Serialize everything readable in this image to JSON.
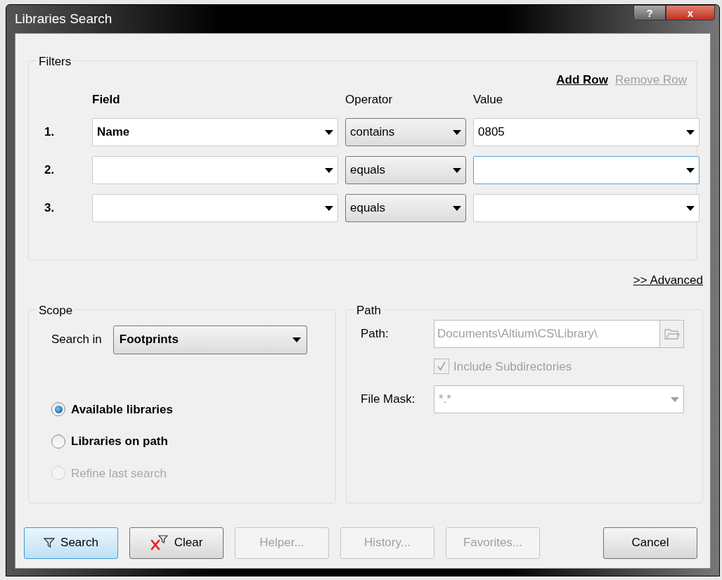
{
  "window": {
    "title": "Libraries Search",
    "help_button": "?",
    "close_button": "x"
  },
  "filters": {
    "title": "Filters",
    "add_row": {
      "label": "Add Row",
      "disabled": false
    },
    "remove_row": {
      "label": "Remove Row",
      "disabled": true
    },
    "columns": [
      "Field",
      "Operator",
      "Value"
    ],
    "rows": [
      {
        "number": "1.",
        "field": "Name",
        "operator": "contains",
        "value": "0805",
        "focused": false
      },
      {
        "number": "2.",
        "operator": "equals",
        "focused": true
      },
      {
        "number": "3.",
        "operator": "equals",
        "focused": false
      }
    ]
  },
  "advanced": ">> Advanced",
  "scope": {
    "title": "Scope",
    "search_in_label": "Search in",
    "search_in_value": "Footprints",
    "options": [
      {
        "label": "Available libraries",
        "selected": true,
        "disabled": false
      },
      {
        "label": "Libraries on path",
        "selected": false,
        "disabled": false
      },
      {
        "label": "Refine last search",
        "selected": false,
        "disabled": true
      }
    ]
  },
  "path": {
    "title": "Path",
    "path_label": "Path:",
    "path_value": "Documents\\Altium\\CS\\Library\\",
    "include_subdirectories": {
      "label": "Include Subdirectories",
      "checked": true,
      "disabled": true
    },
    "file_mask_label": "File Mask:",
    "file_mask_value": "*.*"
  },
  "buttons": [
    {
      "label": "Search",
      "kind": "search",
      "disabled": false,
      "default": true
    },
    {
      "label": "Clear",
      "kind": "clear",
      "disabled": false,
      "default": false
    },
    {
      "label": "Helper...",
      "kind": "plain",
      "disabled": true,
      "default": false
    },
    {
      "label": "History...",
      "kind": "plain",
      "disabled": true,
      "default": false
    },
    {
      "label": "Favorites...",
      "kind": "plain",
      "disabled": true,
      "default": false
    },
    {
      "label": "Cancel",
      "kind": "plain",
      "disabled": false,
      "default": false
    }
  ]
}
